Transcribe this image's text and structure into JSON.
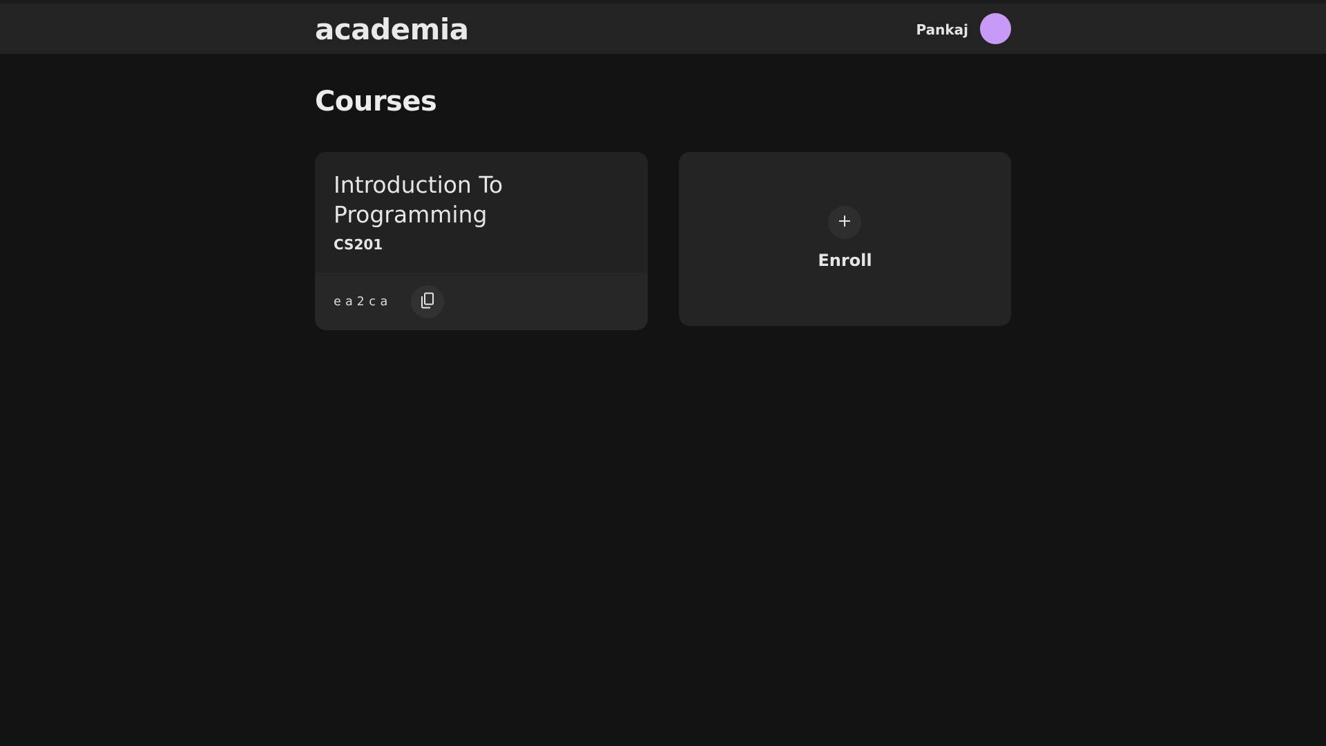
{
  "header": {
    "brand": "academia",
    "user_name": "Pankaj",
    "avatar_color": "#c79af5"
  },
  "main": {
    "title": "Courses",
    "courses": [
      {
        "title": "Introduction To Programming",
        "code": "CS201",
        "join_code": "ea2ca",
        "copy_icon": "copy-icon"
      }
    ],
    "enroll": {
      "icon": "plus-icon",
      "label": "Enroll"
    }
  },
  "colors": {
    "background": "#131313",
    "header": "#232323",
    "card": "#222222"
  }
}
